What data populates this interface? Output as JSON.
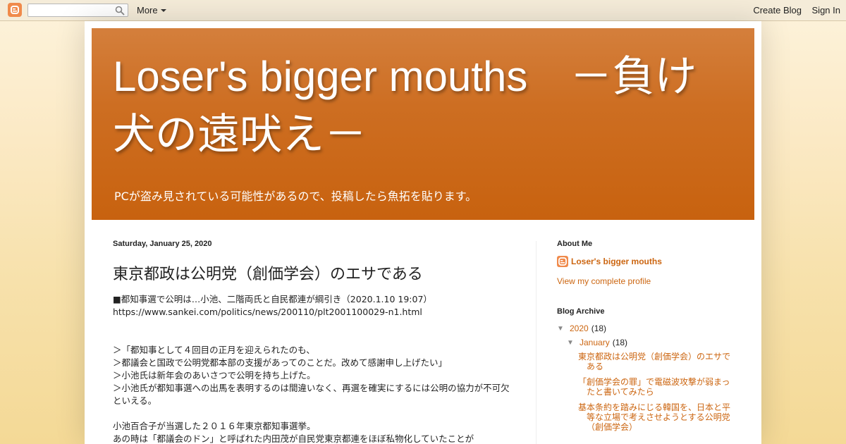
{
  "navbar": {
    "more_label": "More",
    "create_blog_label": "Create Blog",
    "sign_in_label": "Sign In"
  },
  "header": {
    "title": "Loser's bigger mouths　－負け犬の遠吠え－",
    "description": "PCが盗み見されている可能性があるので、投稿したら魚拓を貼ります。"
  },
  "post": {
    "date": "Saturday, January 25, 2020",
    "title": "東京都政は公明党（創価学会）のエサである",
    "lines": {
      "l1": "■都知事選で公明は…小池、二階両氏と自民都連が綱引き（2020.1.10 19:07）",
      "l2": "https://www.sankei.com/politics/news/200110/plt2001100029-n1.html",
      "l3": "＞「都知事として４回目の正月を迎えられたのも、",
      "l4": "＞都議会と国政で公明党都本部の支援があってのことだ。改めて感謝申し上げたい」",
      "l5": "＞小池氏は新年会のあいさつで公明を持ち上げた。",
      "l6": "＞小池氏が都知事選への出馬を表明するのは間違いなく、再選を確実にするには公明の協力が不可欠といえる。",
      "l7": "小池百合子が当選した２０１６年東京都知事選挙。",
      "l8": "あの時は「都議会のドン」と呼ばれた内田茂が自民党東京都連をほぼ私物化していたことが"
    }
  },
  "sidebar": {
    "about_title": "About Me",
    "profile_name": "Loser's bigger mouths",
    "profile_link": "View my complete profile",
    "archive_title": "Blog Archive",
    "archive": {
      "year": "2020",
      "year_count": "(18)",
      "month": "January",
      "month_count": "(18)",
      "posts": [
        "東京都政は公明党（創価学会）のエサである",
        "「創価学会の罪」で電磁波攻撃が弱まったと書いてみたら",
        "基本条約を踏みにじる韓国を、日本と平等な立場で考えさせようとする公明党（創価学会）"
      ]
    }
  }
}
